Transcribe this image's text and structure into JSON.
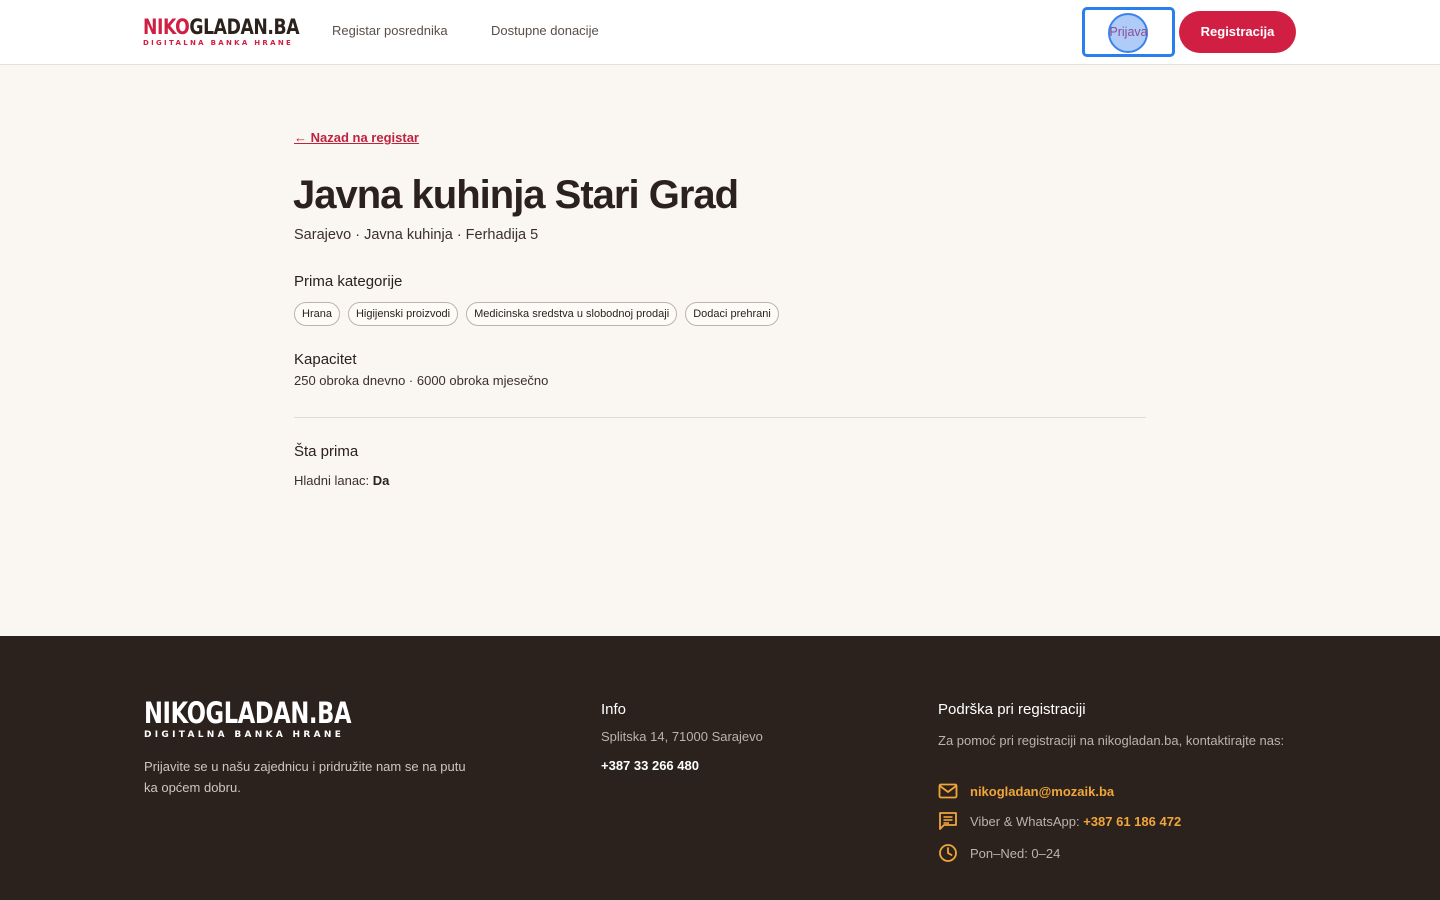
{
  "header": {
    "logo_main_1": "NIKO",
    "logo_main_2": "GLADAN.BA",
    "logo_sub": "DIGITALNA BANKA HRANE",
    "nav": [
      "Registar posrednika",
      "Dostupne donacije"
    ],
    "login_label": "Prijava",
    "register_label": "Registracija"
  },
  "main": {
    "back_link": "← Nazad na registar",
    "title": "Javna kuhinja Stari Grad",
    "subtitle": "Sarajevo · Javna kuhinja · Ferhadija 5",
    "categories_label": "Prima kategorije",
    "categories": [
      "Hrana",
      "Higijenski proizvodi",
      "Medicinska sredstva u slobodnoj prodaji",
      "Dodaci prehrani"
    ],
    "capacity_label": "Kapacitet",
    "capacity_value": "250 obroka dnevno · 6000 obroka mjesečno",
    "accepts_label": "Šta prima",
    "cold_chain_label": "Hladni lanac:",
    "cold_chain_value": "Da"
  },
  "footer": {
    "logo_main": "NIKOGLADAN.BA",
    "logo_sub": "DIGITALNA BANKA HRANE",
    "tagline": "Prijavite se u našu zajednicu i pridružite nam se na putu ka općem dobru.",
    "info_heading": "Info",
    "address": "Splitska 14, 71000 Sarajevo",
    "phone": "+387 33 266 480",
    "support_heading": "Podrška pri registraciji",
    "support_text": "Za pomoć pri registraciji na nikogladan.ba, kontaktirajte nas:",
    "email": "nikogladan@mozaik.ba",
    "messaging_label": "Viber & WhatsApp:",
    "messaging_phone": "+387 61 186 472",
    "hours": "Pon–Ned: 0–24"
  },
  "colors": {
    "brand_red": "#d11f44",
    "footer_bg": "#2b211d",
    "accent_orange": "#f0a63a",
    "page_bg": "#faf6f1"
  },
  "icons": [
    "mail-icon",
    "chat-icon",
    "clock-icon"
  ]
}
